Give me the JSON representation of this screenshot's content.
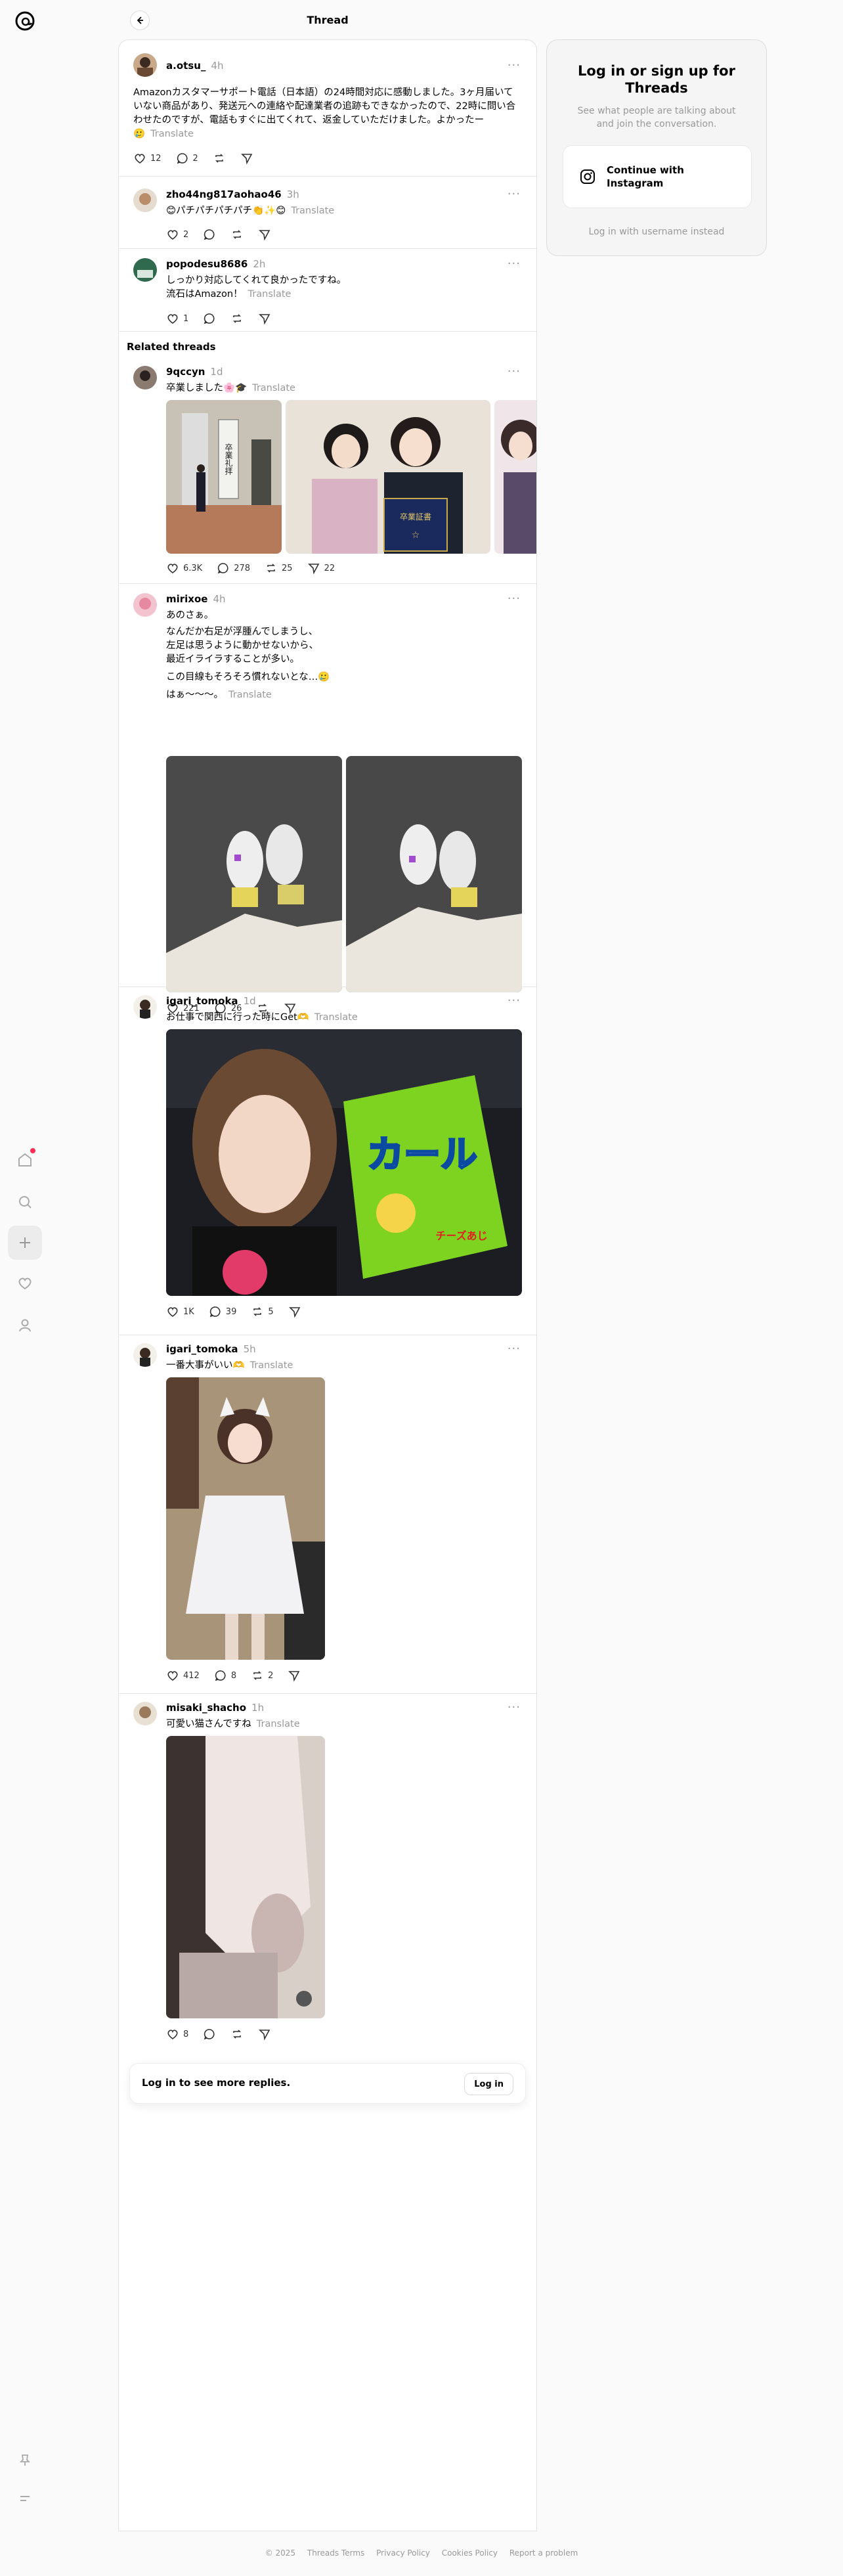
{
  "header": {
    "title": "Thread"
  },
  "login_card": {
    "title": "Log in or sign up for Threads",
    "subtitle": "See what people are talking about and join the conversation.",
    "instagram_button": "Continue with Instagram",
    "username_link": "Log in with username instead"
  },
  "main_post": {
    "username": "a.otsu_",
    "time": "4h",
    "text": "Amazonカスタマーサポート電話（日本語）の24時間対応に感動しました。3ヶ月届いていない商品があり、発送元への連絡や配達業者の追跡もできなかったので、22時に問い合わせたのですが、電話もすぐに出てくれて、返金していただけました。よかったー",
    "text_end": "🥲",
    "translate": "Translate",
    "likes": "12",
    "replies": "2"
  },
  "replies": [
    {
      "username": "zho44ng817aohao46",
      "time": "3h",
      "text": "😊パチパチパチパチ👏✨😊",
      "translate": "Translate",
      "likes": "2"
    },
    {
      "username": "popodesu8686",
      "time": "2h",
      "text_line1": "しっかり対応してくれて良かったですね。",
      "text_line2": "流石はAmazon！",
      "translate": "Translate",
      "likes": "1"
    }
  ],
  "related_title": "Related threads",
  "related": [
    {
      "username": "9qccyn",
      "time": "1d",
      "text": "卒業しました🌸🎓",
      "translate": "Translate",
      "likes": "6.3K",
      "replies": "278",
      "reposts": "25",
      "shares": "22"
    },
    {
      "username": "mirixoe",
      "time": "4h",
      "lines": [
        "あのさぁ。",
        "なんだか右足が浮腫んでしまうし、",
        "左足は思うように動かせないから、",
        "最近イライラすることが多い。",
        "この目線もそろそろ慣れないとな…🥲",
        "はぁ〜〜〜。"
      ],
      "translate": "Translate",
      "likes": "221",
      "replies": "26"
    },
    {
      "username": "igari_tomoka",
      "time": "1d",
      "text": "お仕事で関西に行った時にGet🫶",
      "translate": "Translate",
      "likes": "1K",
      "replies": "39",
      "reposts": "5"
    },
    {
      "username": "igari_tomoka",
      "time": "5h",
      "text": "一番大事がいい🫶",
      "translate": "Translate",
      "likes": "412",
      "replies": "8",
      "reposts": "2"
    },
    {
      "username": "misaki_shacho",
      "time": "1h",
      "text": "可愛い猫さんですね",
      "translate": "Translate",
      "likes": "8"
    }
  ],
  "more_replies": {
    "text": "Log in to see more replies.",
    "button": "Log in"
  },
  "photo_texts": {
    "sign1": "卒業礼拝",
    "folder": "卒業証書",
    "snack_brand": "カール",
    "snack_sub": "チーズあじ"
  },
  "footer": [
    "© 2025",
    "Threads Terms",
    "Privacy Policy",
    "Cookies Policy",
    "Report a problem"
  ],
  "colors": {
    "accent_red": "#ff2d55",
    "muted": "#999999",
    "border": "#e2e2e2"
  }
}
